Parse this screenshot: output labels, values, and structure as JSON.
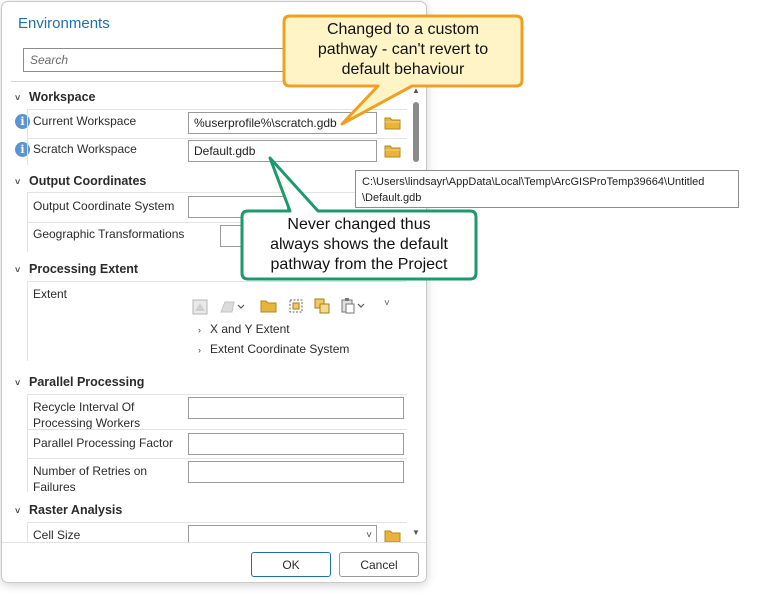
{
  "dialog": {
    "title": "Environments",
    "search_placeholder": "Search"
  },
  "sections": {
    "workspace": "Workspace",
    "output_coordinates": "Output Coordinates",
    "processing_extent": "Processing Extent",
    "parallel_processing": "Parallel Processing",
    "raster_analysis": "Raster Analysis"
  },
  "rows": {
    "current_workspace": {
      "label": "Current Workspace",
      "value": "%userprofile%\\scratch.gdb"
    },
    "scratch_workspace": {
      "label": "Scratch Workspace",
      "value": "Default.gdb"
    },
    "output_coordinate_system": {
      "label": "Output Coordinate System"
    },
    "geographic_transformations": {
      "label": "Geographic Transformations"
    },
    "extent": {
      "label": "Extent"
    },
    "recycle_interval": {
      "label": "Recycle Interval Of\nProcessing Workers"
    },
    "parallel_factor": {
      "label": "Parallel Processing Factor"
    },
    "number_of_retries": {
      "label": "Number of Retries on\nFailures"
    },
    "cell_size": {
      "label": "Cell Size"
    }
  },
  "extent_subitems": {
    "xy_extent": "X and Y Extent",
    "extent_coord_system": "Extent Coordinate System"
  },
  "tooltip": {
    "text": "C:\\Users\\lindsayr\\AppData\\Local\\Temp\\ArcGISProTemp39664\\Untitled\n\\Default.gdb"
  },
  "buttons": {
    "ok": "OK",
    "cancel": "Cancel"
  },
  "callouts": {
    "top": "Changed to a custom\npathway - can't revert to\ndefault behaviour",
    "middle": "Never changed thus\nalways shows the default\npathway from the Project"
  },
  "colors": {
    "title_blue": "#1f6fb0",
    "info_blue": "#5b94d0",
    "folder_yellow": "#e8b53a",
    "callout_orange_border": "#f0a020",
    "callout_orange_fill": "#fff4c6",
    "callout_green_border": "#1d9a6c",
    "callout_green_fill": "#ffffff"
  }
}
